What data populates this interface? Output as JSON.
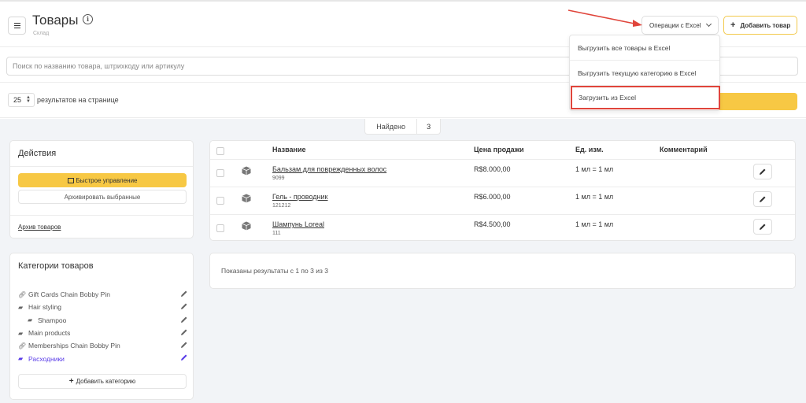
{
  "header": {
    "title": "Товары",
    "subtitle": "Склад",
    "excel_button": "Операции с Excel",
    "add_button": "Добавить товар"
  },
  "search": {
    "placeholder": "Поиск по названию товара, штрихкоду или артикулу"
  },
  "pagination": {
    "per_page": "25",
    "per_page_label": "результатов на странице"
  },
  "found": {
    "label": "Найдено",
    "count": "3"
  },
  "actions": {
    "title": "Действия",
    "quick_manage": "Быстрое управление",
    "archive_selected": "Архивировать выбранные",
    "archive_link": "Архив товаров"
  },
  "categories": {
    "title": "Категории товаров",
    "items": [
      {
        "label": "Gift Cards Chain Bobby Pin",
        "icon": "link-icon"
      },
      {
        "label": "Hair styling",
        "icon": "folder-icon"
      },
      {
        "label": "Shampoo",
        "icon": "folder-icon"
      },
      {
        "label": "Main products",
        "icon": "folder-icon"
      },
      {
        "label": "Memberships Chain Bobby Pin",
        "icon": "link-icon"
      },
      {
        "label": "Расходники",
        "icon": "folder-open-icon"
      }
    ],
    "add_button": "Добавить категорию",
    "active_color": "#5b3ee8"
  },
  "table": {
    "headers": [
      "Название",
      "Цена продажи",
      "Ед. изм.",
      "Комментарий"
    ],
    "rows": [
      {
        "name": "Бальзам для поврежденных волос",
        "code": "9099",
        "price": "R$8.000,00",
        "unit": "1 мл = 1 мл",
        "comment": ""
      },
      {
        "name": "Гель - проводник",
        "code": "121212",
        "price": "R$6.000,00",
        "unit": "1 мл = 1 мл",
        "comment": ""
      },
      {
        "name": "Шампунь Loreal",
        "code": "111",
        "price": "R$4.500,00",
        "unit": "1 мл = 1 мл",
        "comment": ""
      }
    ]
  },
  "results": {
    "text": "Показаны результаты с 1 по 3 из 3"
  },
  "dropdown": {
    "items": [
      "Выгрузить все товары в Excel",
      "Выгрузить текущую категорию в Excel",
      "Загрузить из Excel"
    ],
    "highlight_color": "#e0453b"
  },
  "colors": {
    "accent_yellow": "#f7c844",
    "background": "#f2f4f7"
  }
}
